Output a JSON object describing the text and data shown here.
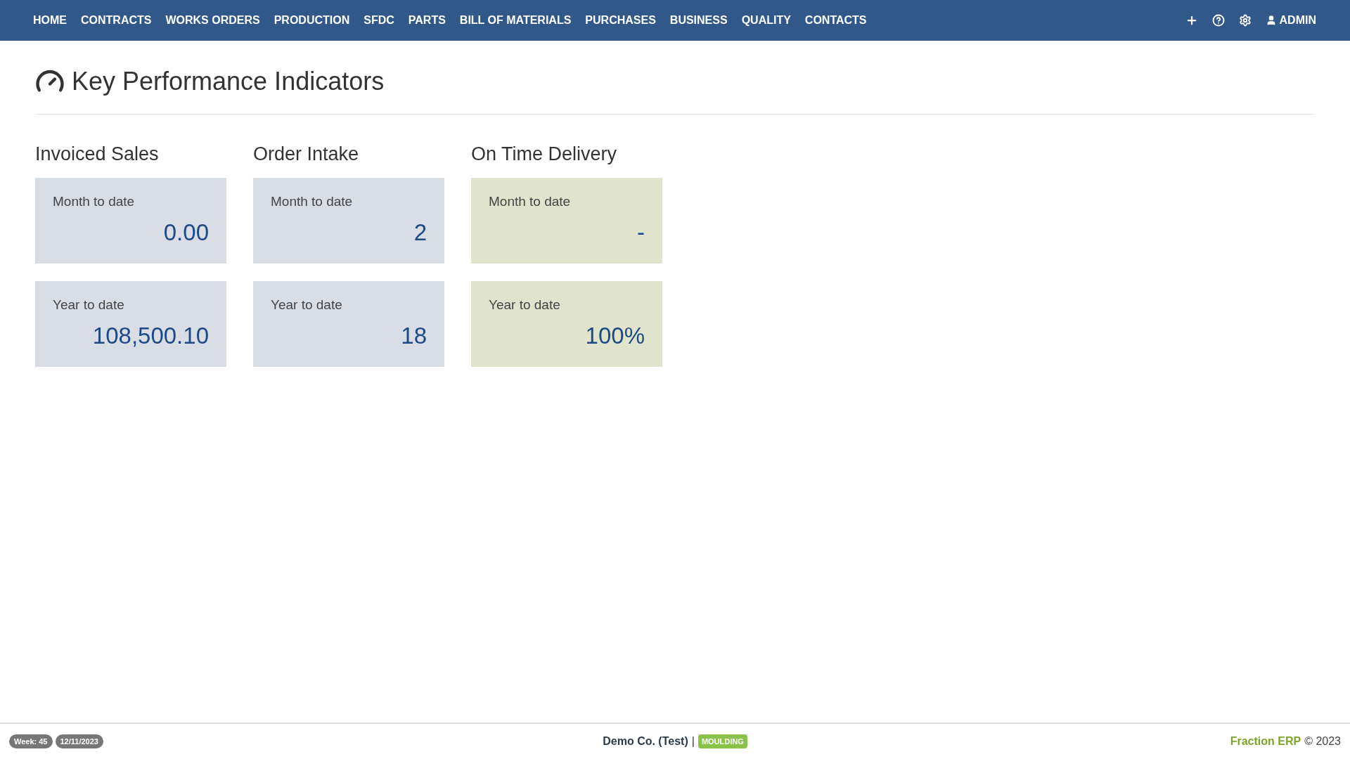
{
  "nav": {
    "items": [
      "HOME",
      "CONTRACTS",
      "WORKS ORDERS",
      "PRODUCTION",
      "SFDC",
      "PARTS",
      "BILL OF MATERIALS",
      "PURCHASES",
      "BUSINESS",
      "QUALITY",
      "CONTACTS"
    ],
    "user": "ADMIN"
  },
  "page": {
    "title": "Key Performance Indicators"
  },
  "groups": [
    {
      "title": "Invoiced Sales",
      "color": "#d8dde6",
      "cards": [
        {
          "label": "Month to date",
          "value": "0.00"
        },
        {
          "label": "Year to date",
          "value": "108,500.10"
        }
      ]
    },
    {
      "title": "Order Intake",
      "color": "#d8dde6",
      "cards": [
        {
          "label": "Month to date",
          "value": "2"
        },
        {
          "label": "Year to date",
          "value": "18"
        }
      ]
    },
    {
      "title": "On Time Delivery",
      "color": "#e0e4cc",
      "cards": [
        {
          "label": "Month to date",
          "value": "-"
        },
        {
          "label": "Year to date",
          "value": "100%"
        }
      ]
    }
  ],
  "footer": {
    "week": "Week: 45",
    "date": "12/11/2023",
    "company": "Demo Co. (Test)",
    "separator": "|",
    "mode": "MOULDING",
    "brand": "Fraction ERP",
    "copyright": "© 2023"
  }
}
